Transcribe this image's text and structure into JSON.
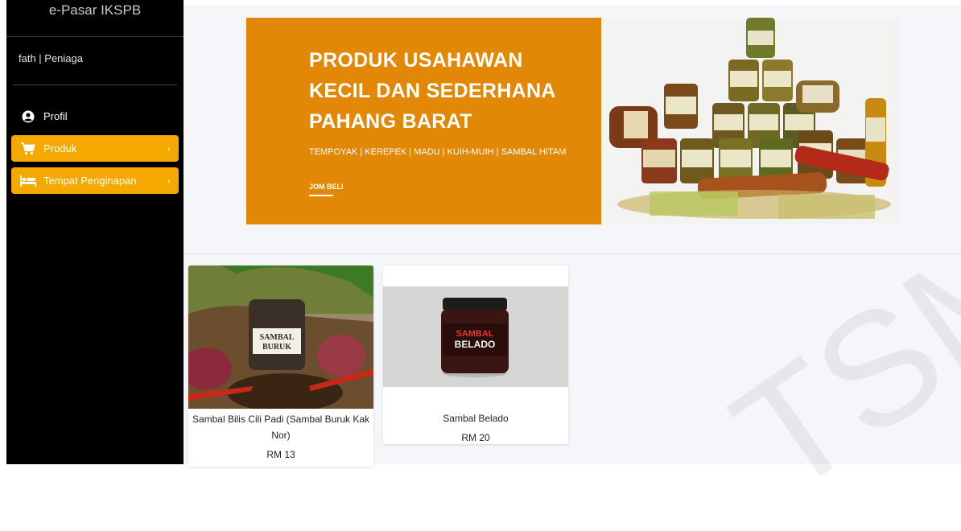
{
  "sidebar": {
    "brand": "e-Pasar IKSPB",
    "user": "fath | Peniaga",
    "items": [
      {
        "label": "Profil",
        "icon": "user-circle-icon",
        "active": false
      },
      {
        "label": "Produk",
        "icon": "cart-icon",
        "active": true
      },
      {
        "label": "Tempat Penginapan",
        "icon": "bed-icon",
        "active": true
      }
    ],
    "active_color": "#f5a800"
  },
  "banner": {
    "title": "PRODUK USAHAWAN KECIL DAN SEDERHANA PAHANG BARAT",
    "subtitle": "TEMPOYAK | KEREPEK | MADU | KUIH-MUIH | SAMBAL HITAM",
    "cta": "JOM BELI",
    "color": "#e28806"
  },
  "products": [
    {
      "name": "Sambal Bilis Cili Padi (Sambal Buruk Kak Nor)",
      "price": "RM 13",
      "image_label": "SAMBAL BURUK"
    },
    {
      "name": "Sambal Belado",
      "price": "RM 20",
      "image_label": "SAMBAL BELADO"
    }
  ],
  "watermark": "TSM"
}
